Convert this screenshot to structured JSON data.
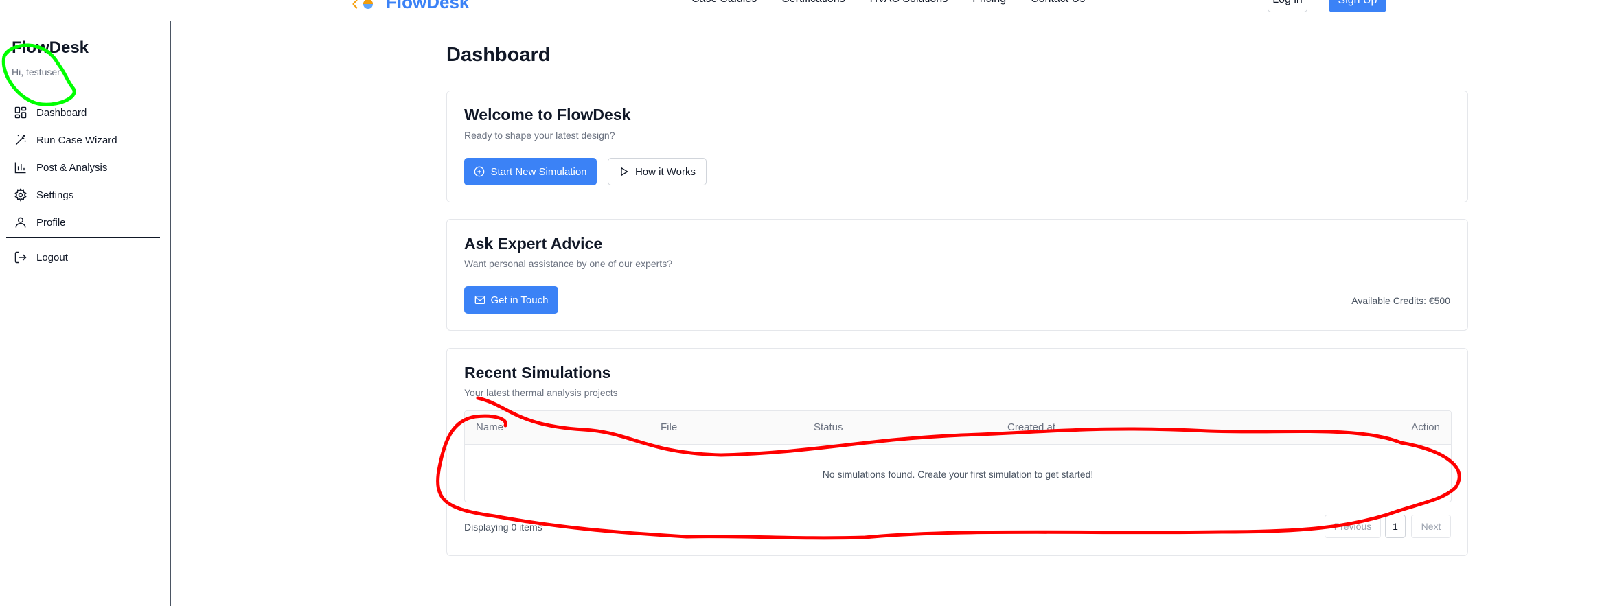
{
  "topnav": {
    "brand": "FlowDesk",
    "links": [
      "Case Studies",
      "Certifications",
      "HVAC Solutions",
      "Pricing",
      "Contact Us"
    ],
    "login": "Log in",
    "signup": "Sign Up"
  },
  "sidebar": {
    "title": "FlowDesk",
    "greeting": "Hi, testuser",
    "items": [
      {
        "label": "Dashboard",
        "icon": "dashboard-icon"
      },
      {
        "label": "Run Case Wizard",
        "icon": "wand-icon"
      },
      {
        "label": "Post & Analysis",
        "icon": "bar-chart-icon"
      },
      {
        "label": "Settings",
        "icon": "gear-icon"
      },
      {
        "label": "Profile",
        "icon": "user-icon"
      }
    ],
    "logout": "Logout"
  },
  "main": {
    "title": "Dashboard",
    "welcome": {
      "title": "Welcome to FlowDesk",
      "subtitle": "Ready to shape your latest design?",
      "start_button": "Start New Simulation",
      "how_button": "How it Works"
    },
    "expert": {
      "title": "Ask Expert Advice",
      "subtitle": "Want personal assistance by one of our experts?",
      "contact_button": "Get in Touch",
      "credits": "Available Credits: €500"
    },
    "recent": {
      "title": "Recent Simulations",
      "subtitle": "Your latest thermal analysis projects",
      "columns": [
        "Name",
        "File",
        "Status",
        "Created at",
        "Action"
      ],
      "empty_message": "No simulations found. Create your first simulation to get started!",
      "displaying": "Displaying 0 items",
      "pagination": {
        "previous": "Previous",
        "page": "1",
        "next": "Next"
      }
    }
  },
  "colors": {
    "accent": "#3b82f6",
    "annotation_green": "#00ff00",
    "annotation_red": "#ff0000"
  }
}
